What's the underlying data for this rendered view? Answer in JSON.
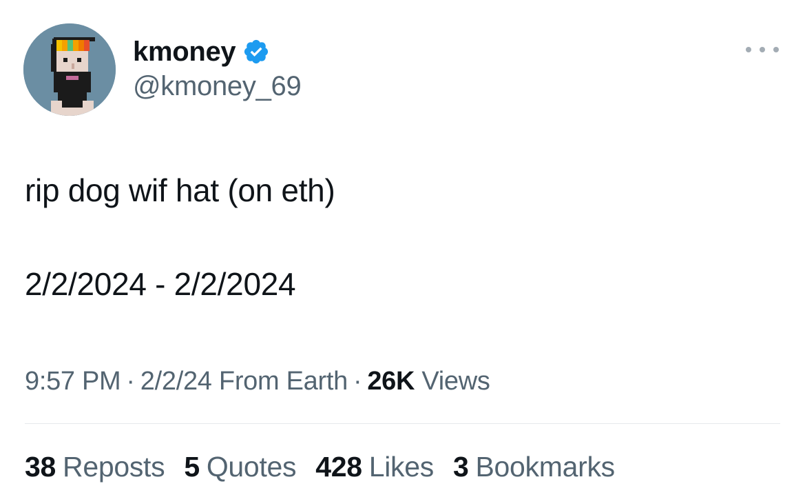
{
  "author": {
    "display_name": "kmoney",
    "handle": "@kmoney_69",
    "verified": true,
    "verified_color": "#1d9bf0",
    "avatar_icon": "pixel-punk-avatar"
  },
  "menu": {
    "icon": "more-horizontal-icon"
  },
  "tweet": {
    "line1": "rip dog wif hat (on eth)",
    "line2": "2/2/2024 - 2/2/2024"
  },
  "meta": {
    "time": "9:57 PM",
    "date": "2/2/24",
    "source": "From Earth",
    "separator": "·",
    "views_count": "26K",
    "views_label": "Views"
  },
  "stats": {
    "reposts_count": "38",
    "reposts_label": "Reposts",
    "quotes_count": "5",
    "quotes_label": "Quotes",
    "likes_count": "428",
    "likes_label": "Likes",
    "bookmarks_count": "3",
    "bookmarks_label": "Bookmarks"
  },
  "colors": {
    "text_primary": "#0f1419",
    "text_secondary": "#536471",
    "divider": "#e6e9ec"
  }
}
